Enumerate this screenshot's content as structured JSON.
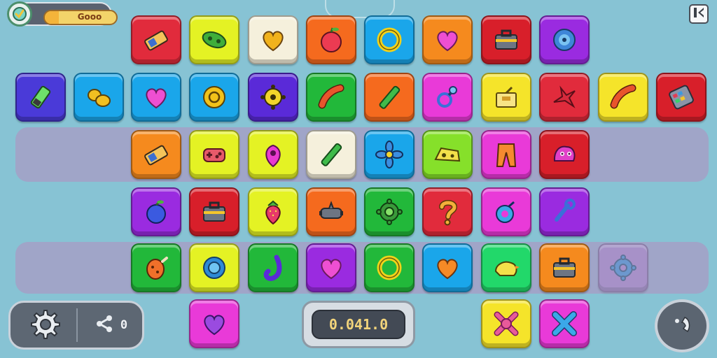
{
  "hud": {
    "progress_label": "Gooo",
    "progress": 0.2,
    "badge_icon": "checkmark-badge-icon",
    "pause_icon": "pause-icon"
  },
  "controls": {
    "settings_icon": "gear-icon",
    "share_icon": "share-icon",
    "share_count": "0",
    "call_icon": "phone-icon"
  },
  "score": {
    "value": "0.041.0"
  },
  "colors": {
    "background": "#87c3d4",
    "lane": "#b48cbe"
  },
  "tiles": [
    {
      "row": 0,
      "col": 2,
      "color": "#e12b3c",
      "icon": "battery"
    },
    {
      "row": 0,
      "col": 3,
      "color": "#e4f224",
      "icon": "capsule"
    },
    {
      "row": 0,
      "col": 4,
      "color": "#f5f0dc",
      "icon": "heart-gold"
    },
    {
      "row": 0,
      "col": 5,
      "color": "#f56a1e",
      "icon": "apple"
    },
    {
      "row": 0,
      "col": 6,
      "color": "#1aa6ea",
      "icon": "ring-yellow"
    },
    {
      "row": 0,
      "col": 7,
      "color": "#f58a1e",
      "icon": "heart-pink"
    },
    {
      "row": 0,
      "col": 8,
      "color": "#d81f2a",
      "icon": "toolbox"
    },
    {
      "row": 0,
      "col": 9,
      "color": "#9a2be0",
      "icon": "shell"
    },
    {
      "row": 1,
      "col": 0,
      "color": "#4a3ad8",
      "icon": "marker"
    },
    {
      "row": 1,
      "col": 1,
      "color": "#1aa6ea",
      "icon": "peanut"
    },
    {
      "row": 1,
      "col": 2,
      "color": "#1aa6ea",
      "icon": "heart-pink"
    },
    {
      "row": 1,
      "col": 3,
      "color": "#1aa6ea",
      "icon": "coin"
    },
    {
      "row": 1,
      "col": 4,
      "color": "#5a2ad8",
      "icon": "gear-yellow"
    },
    {
      "row": 1,
      "col": 5,
      "color": "#22b83a",
      "icon": "sausage"
    },
    {
      "row": 1,
      "col": 6,
      "color": "#f56a1e",
      "icon": "stick"
    },
    {
      "row": 1,
      "col": 7,
      "color": "#e93ad8",
      "icon": "pacifier"
    },
    {
      "row": 1,
      "col": 8,
      "color": "#f5e42a",
      "icon": "box"
    },
    {
      "row": 1,
      "col": 9,
      "color": "#e12b3c",
      "icon": "star-red"
    },
    {
      "row": 1,
      "col": 10,
      "color": "#f5e42a",
      "icon": "sausage"
    },
    {
      "row": 1,
      "col": 11,
      "color": "#d81f2a",
      "icon": "keypad"
    },
    {
      "row": 2,
      "col": 2,
      "color": "#f58a1e",
      "icon": "battery"
    },
    {
      "row": 2,
      "col": 3,
      "color": "#e4f224",
      "icon": "gamepad"
    },
    {
      "row": 2,
      "col": 4,
      "color": "#e4f224",
      "icon": "berry"
    },
    {
      "row": 2,
      "col": 5,
      "color": "#f5f0dc",
      "icon": "stick"
    },
    {
      "row": 2,
      "col": 6,
      "color": "#1aa6ea",
      "icon": "flower"
    },
    {
      "row": 2,
      "col": 7,
      "color": "#86e02a",
      "icon": "cheese"
    },
    {
      "row": 2,
      "col": 8,
      "color": "#e93ad8",
      "icon": "pants"
    },
    {
      "row": 2,
      "col": 9,
      "color": "#d81f2a",
      "icon": "monster"
    },
    {
      "row": 3,
      "col": 2,
      "color": "#9a2be0",
      "icon": "plum"
    },
    {
      "row": 3,
      "col": 3,
      "color": "#d81f2a",
      "icon": "toolbox"
    },
    {
      "row": 3,
      "col": 4,
      "color": "#e4f224",
      "icon": "strawberry"
    },
    {
      "row": 3,
      "col": 5,
      "color": "#f56a1e",
      "icon": "pot"
    },
    {
      "row": 3,
      "col": 6,
      "color": "#22b83a",
      "icon": "gear-green"
    },
    {
      "row": 3,
      "col": 7,
      "color": "#e12b3c",
      "icon": "question"
    },
    {
      "row": 3,
      "col": 8,
      "color": "#e93ad8",
      "icon": "plum-blue"
    },
    {
      "row": 3,
      "col": 9,
      "color": "#9a2be0",
      "icon": "hook"
    },
    {
      "row": 4,
      "col": 2,
      "color": "#22b83a",
      "icon": "chicken"
    },
    {
      "row": 4,
      "col": 3,
      "color": "#e4f224",
      "icon": "ring-blue"
    },
    {
      "row": 4,
      "col": 4,
      "color": "#22b83a",
      "icon": "hook-purple"
    },
    {
      "row": 4,
      "col": 5,
      "color": "#9a2be0",
      "icon": "heart-pink"
    },
    {
      "row": 4,
      "col": 6,
      "color": "#22b83a",
      "icon": "ring-yellow"
    },
    {
      "row": 4,
      "col": 7,
      "color": "#1aa6ea",
      "icon": "heart-orange"
    },
    {
      "row": 4,
      "col": 8,
      "color": "#22d86a",
      "icon": "duck"
    },
    {
      "row": 4,
      "col": 9,
      "color": "#f58a1e",
      "icon": "toolbox"
    },
    {
      "row": 4,
      "col": 10,
      "color": "#b07ac8",
      "icon": "gear-blue",
      "faded": true
    },
    {
      "row": 5,
      "col": 3,
      "color": "#e93ad8",
      "icon": "heart-purple"
    },
    {
      "row": 5,
      "col": 8,
      "color": "#f5e42a",
      "icon": "cross-pink"
    },
    {
      "row": 5,
      "col": 9,
      "color": "#e93ad8",
      "icon": "cross-blue"
    }
  ]
}
